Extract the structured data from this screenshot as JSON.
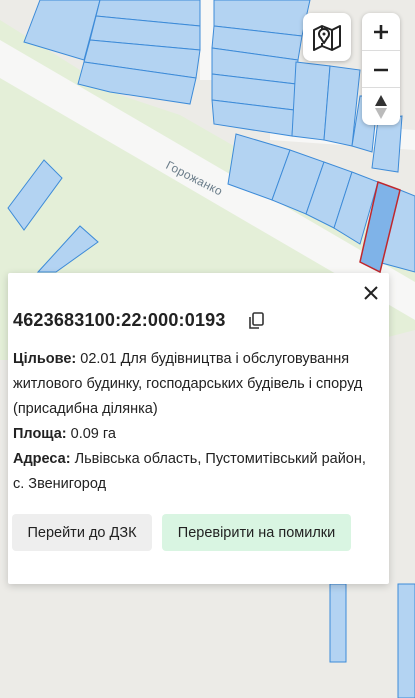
{
  "map": {
    "street_label": "Горожанко",
    "colors": {
      "background": "#ecebe7",
      "road": "#f7f7f6",
      "green": "#e4efd8",
      "parcel_fill": "#b3d3f2",
      "parcel_stroke": "#3d8bd8",
      "selected_stroke": "#c0272d"
    }
  },
  "controls": {
    "layers_icon": "map-layers-icon",
    "zoom_in": "+",
    "zoom_out": "−",
    "north_icon": "compass-north-icon"
  },
  "parcel": {
    "cadastral_number": "4623683100:22:000:0193",
    "purpose_label": "Цільове:",
    "purpose_value": "02.01 Для будівництва і обслуговування житлового будинку, господарських будівель і споруд (присадибна ділянка)",
    "area_label": "Площа:",
    "area_value": "0.09 га",
    "address_label": "Адреса:",
    "address_value": "Львівська область, Пустомитівський район, с. Звенигород"
  },
  "actions": {
    "go_to_dzk": "Перейти до ДЗК",
    "check_errors": "Перевірити на помилки"
  }
}
